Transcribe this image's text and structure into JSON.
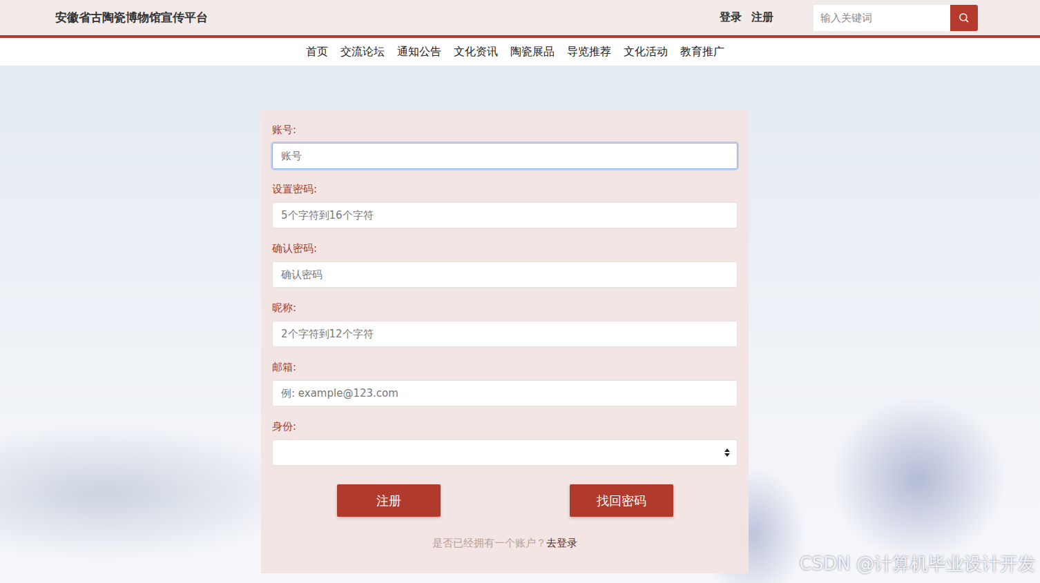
{
  "header": {
    "title": "安徽省古陶瓷博物馆宣传平台",
    "links": [
      {
        "label": "登录"
      },
      {
        "label": "注册"
      }
    ],
    "search": {
      "placeholder": "输入关键词"
    }
  },
  "nav": {
    "items": [
      {
        "label": "首页"
      },
      {
        "label": "交流论坛"
      },
      {
        "label": "通知公告"
      },
      {
        "label": "文化资讯"
      },
      {
        "label": "陶瓷展品"
      },
      {
        "label": "导览推荐"
      },
      {
        "label": "文化活动"
      },
      {
        "label": "教育推广"
      }
    ]
  },
  "form": {
    "fields": [
      {
        "label": "账号:",
        "placeholder": "账号",
        "kind": "input",
        "focused": true
      },
      {
        "label": "设置密码:",
        "placeholder": "5个字符到16个字符",
        "kind": "input",
        "focused": false
      },
      {
        "label": "确认密码:",
        "placeholder": "确认密码",
        "kind": "input",
        "focused": false
      },
      {
        "label": "昵称:",
        "placeholder": "2个字符到12个字符",
        "kind": "input",
        "focused": false
      },
      {
        "label": "邮箱:",
        "placeholder": "例: example@123.com",
        "kind": "input",
        "focused": false
      },
      {
        "label": "身份:",
        "placeholder": "",
        "kind": "select",
        "focused": false
      }
    ],
    "buttons": [
      {
        "label": "注册"
      },
      {
        "label": "找回密码"
      }
    ],
    "footer": {
      "prompt": "是否已经拥有一个账户？",
      "link": "去登录"
    }
  },
  "watermark": "CSDN @计算机毕业设计开发"
}
